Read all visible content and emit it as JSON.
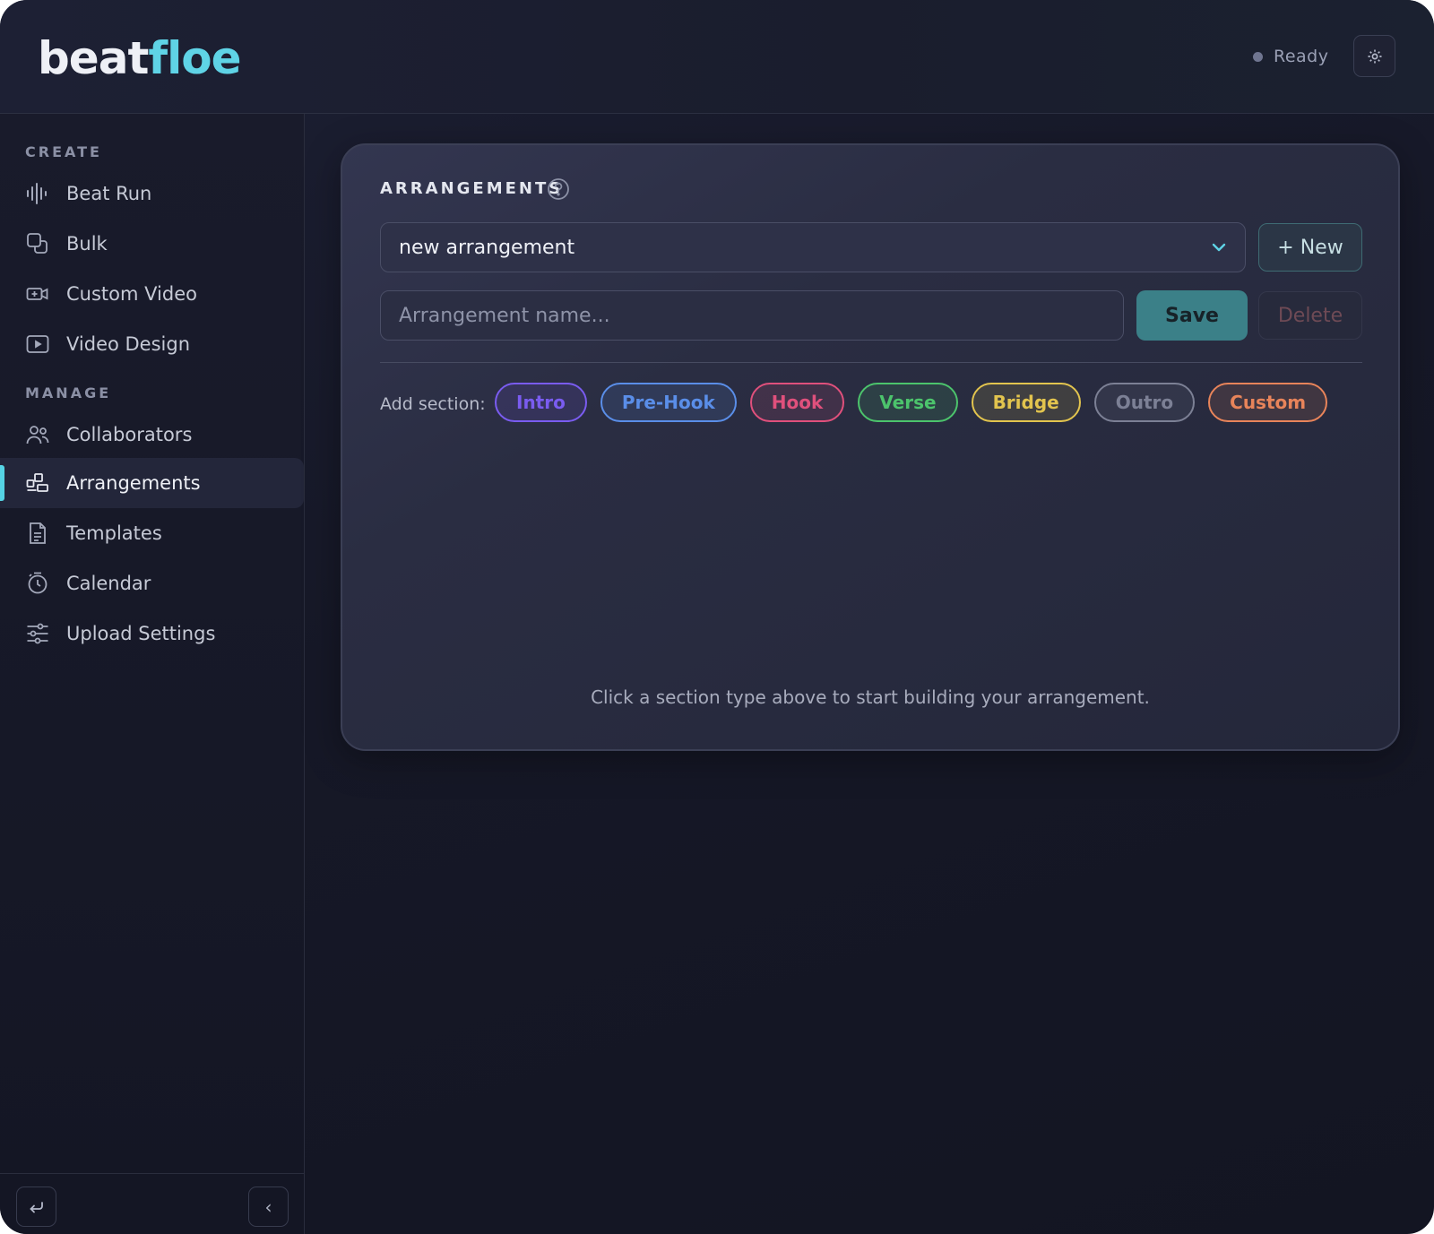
{
  "app": {
    "logo_part1": "beat",
    "logo_part2": "floe",
    "status": "Ready"
  },
  "sidebar": {
    "groups": [
      {
        "label": "CREATE"
      },
      {
        "label": "MANAGE"
      }
    ],
    "items": [
      {
        "label": "Beat Run",
        "icon": "waveform-icon"
      },
      {
        "label": "Bulk",
        "icon": "copy-icon"
      },
      {
        "label": "Custom Video",
        "icon": "video-camera-icon"
      },
      {
        "label": "Video Design",
        "icon": "play-icon"
      },
      {
        "label": "Collaborators",
        "icon": "users-icon"
      },
      {
        "label": "Arrangements",
        "icon": "blocks-icon",
        "active": true
      },
      {
        "label": "Templates",
        "icon": "document-icon"
      },
      {
        "label": "Calendar",
        "icon": "timer-icon"
      },
      {
        "label": "Upload Settings",
        "icon": "sliders-icon"
      }
    ],
    "footer": {
      "back_icon": "return-icon",
      "collapse_icon": "chevron-left-icon",
      "collapse_glyph": "‹"
    }
  },
  "card": {
    "title": "ARRANGEMENTS",
    "select_value": "new arrangement",
    "new_button": "+ New",
    "name_placeholder": "Arrangement name...",
    "save_button": "Save",
    "delete_button": "Delete",
    "add_section_label": "Add section:",
    "chips": [
      {
        "label": "Intro",
        "color": "#7a5cf0"
      },
      {
        "label": "Pre-Hook",
        "color": "#5a8ee8"
      },
      {
        "label": "Hook",
        "color": "#e0507c"
      },
      {
        "label": "Verse",
        "color": "#4cc46c"
      },
      {
        "label": "Bridge",
        "color": "#e2c44e"
      },
      {
        "label": "Outro",
        "color": "#7c8095"
      },
      {
        "label": "Custom",
        "color": "#e8845a"
      }
    ],
    "empty_message": "Click a section type above to start building your arrangement."
  },
  "colors": {
    "accent": "#55d3e4",
    "logo_accent": "#5fd3e6",
    "save": "#3b8088"
  }
}
